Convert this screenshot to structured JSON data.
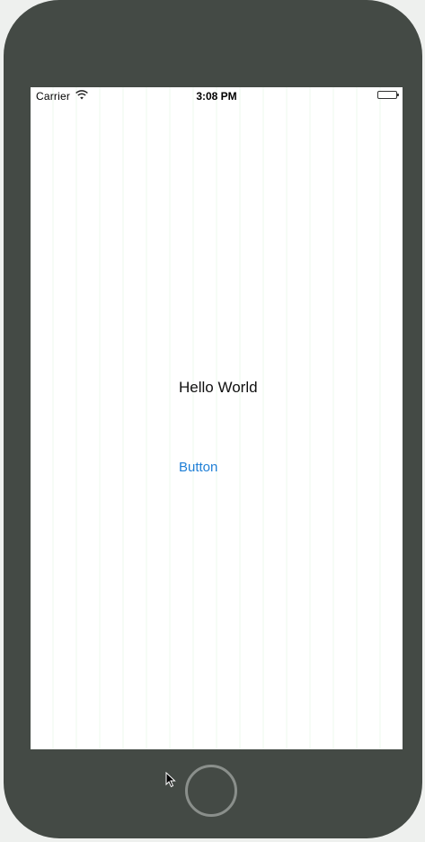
{
  "status_bar": {
    "carrier": "Carrier",
    "time": "3:08 PM",
    "wifi_icon": "wifi-icon",
    "battery_icon": "battery-icon"
  },
  "content": {
    "label_text": "Hello World",
    "button_label": "Button"
  },
  "device": {
    "home_button_icon": "home-button-circle",
    "pointer_icon": "mouse-pointer-icon"
  },
  "colors": {
    "device_body": "#444a45",
    "screen_background": "#ffffff",
    "button_tint": "#1f7fd6",
    "label_text": "#111111"
  }
}
